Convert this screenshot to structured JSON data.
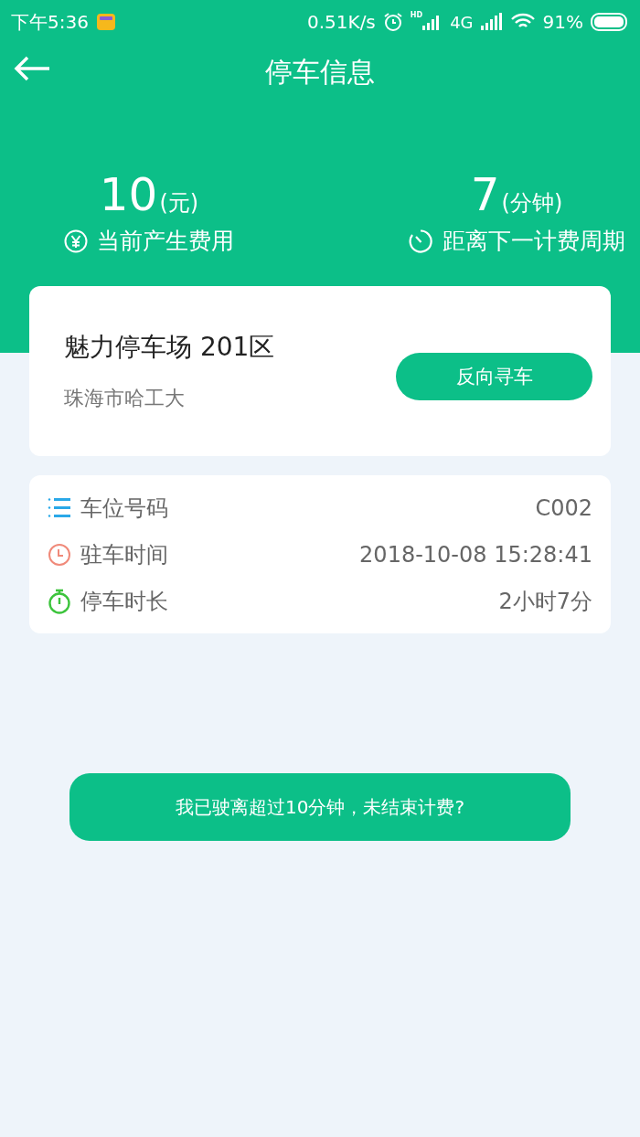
{
  "status_bar": {
    "time": "下午5:36",
    "speed": "0.51K/s",
    "hd": "HD",
    "network": "4G",
    "battery": "91%"
  },
  "header": {
    "title": "停车信息"
  },
  "summary": [
    {
      "value": "10",
      "unit": "(元)",
      "label": "当前产生费用",
      "kind": "fee"
    },
    {
      "value": "7",
      "unit": "(分钟)",
      "label": "距离下一计费周期",
      "kind": "timer"
    }
  ],
  "lot": {
    "name": "魅力停车场 201区",
    "address": "珠海市哈工大",
    "button": "反向寻车"
  },
  "details": [
    {
      "kind": "number",
      "label": "车位号码",
      "value": "C002"
    },
    {
      "kind": "time",
      "label": "驻车时间",
      "value": "2018-10-08 15:28:41"
    },
    {
      "kind": "duration",
      "label": "停车时长",
      "value": "2小时7分"
    }
  ],
  "action": "我已驶离超过10分钟，未结束计费?"
}
